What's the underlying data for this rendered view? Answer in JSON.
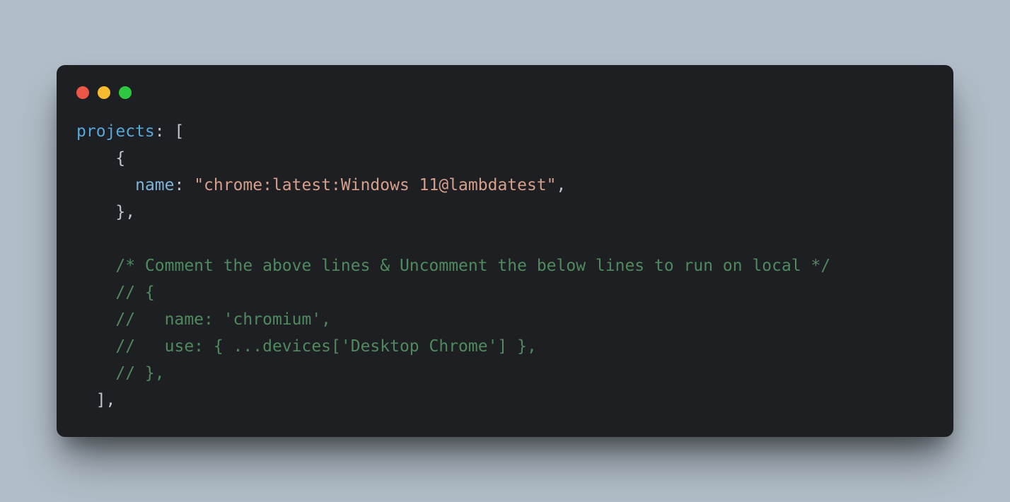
{
  "colors": {
    "background": "#b1bdc8",
    "window_bg": "#1e1f22",
    "traffic_red": "#ec5648",
    "traffic_yellow": "#f6bb2e",
    "traffic_green": "#2ec840",
    "token_key": "#57a8d8",
    "token_prop": "#7fb4d6",
    "token_punct": "#c0c6cc",
    "token_string": "#d69f8b",
    "token_comment": "#4f8a5f"
  },
  "code": {
    "line1": {
      "key": "projects",
      "colon_space": ": ",
      "open": "["
    },
    "line2": {
      "indent": "    ",
      "open": "{"
    },
    "line3": {
      "indent": "      ",
      "prop": "name",
      "colon_space": ": ",
      "string": "\"chrome:latest:Windows 11@lambdatest\"",
      "comma": ","
    },
    "line4": {
      "indent": "    ",
      "close": "},"
    },
    "line5": "",
    "line6": {
      "indent": "    ",
      "comment": "/* Comment the above lines & Uncomment the below lines to run on local */"
    },
    "line7": {
      "indent": "    ",
      "comment": "// {"
    },
    "line8": {
      "indent": "    ",
      "comment": "//   name: 'chromium',"
    },
    "line9": {
      "indent": "    ",
      "comment": "//   use: { ...devices['Desktop Chrome'] },"
    },
    "line10": {
      "indent": "    ",
      "comment": "// },"
    },
    "line11": {
      "indent": "  ",
      "close": "],"
    }
  }
}
